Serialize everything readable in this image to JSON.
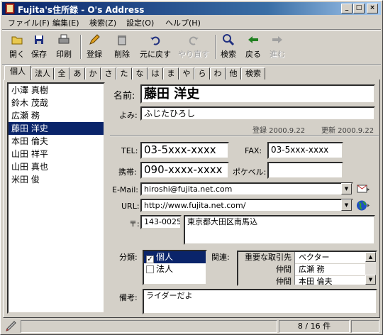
{
  "window": {
    "title": "Fujita's住所録 - O's Address"
  },
  "menu": [
    "ファイル(F)",
    "編集(E)",
    "検索(Z)",
    "設定(O)",
    "ヘルプ(H)"
  ],
  "toolbar": {
    "open": "開く",
    "save": "保存",
    "print": "印刷",
    "register": "登録",
    "delete": "削除",
    "undo": "元に戻す",
    "redo": "やり直す",
    "search": "検索",
    "back": "戻る",
    "forward": "進む"
  },
  "tabs": [
    "個人",
    "法人",
    "全",
    "あ",
    "か",
    "さ",
    "た",
    "な",
    "は",
    "ま",
    "や",
    "ら",
    "わ",
    "他",
    "検索"
  ],
  "contacts": [
    "小澤 真樹",
    "鈴木 茂哉",
    "広瀬 務",
    "藤田 洋史",
    "本田 倫夫",
    "山田 祥平",
    "山田 真也",
    "米田 俊"
  ],
  "detail": {
    "name_label": "名前:",
    "name": "藤田 洋史",
    "yomi_label": "よみ:",
    "yomi": "ふじたひろし",
    "registered": "登録 2000.9.22",
    "updated": "更新 2000.9.22",
    "tel_label": "TEL:",
    "tel": "03-5xxx-xxxx",
    "fax_label": "FAX:",
    "fax": "03-5xxx-xxxx",
    "mobile_label": "携帯:",
    "mobile": "090-xxxx-xxxx",
    "pager_label": "ポケベル:",
    "pager": "",
    "email_label": "E-Mail:",
    "email": "hiroshi@fujita.net.com",
    "url_label": "URL:",
    "url": "http://www.fujita.net.com/",
    "zip_label": "〒:",
    "zip": "143-0025",
    "address": "東京都大田区南馬込",
    "category_label": "分類:",
    "categories": [
      "個人",
      "法人"
    ],
    "related_label": "関連:",
    "related": [
      {
        "rel": "重要な取引先",
        "name": "ベクター"
      },
      {
        "rel": "仲間",
        "name": "広瀬 務"
      },
      {
        "rel": "仲間",
        "name": "本田 倫夫"
      }
    ],
    "notes_label": "備考:",
    "notes": "ライダーだよ"
  },
  "status": {
    "count": "8 / 16 件"
  }
}
